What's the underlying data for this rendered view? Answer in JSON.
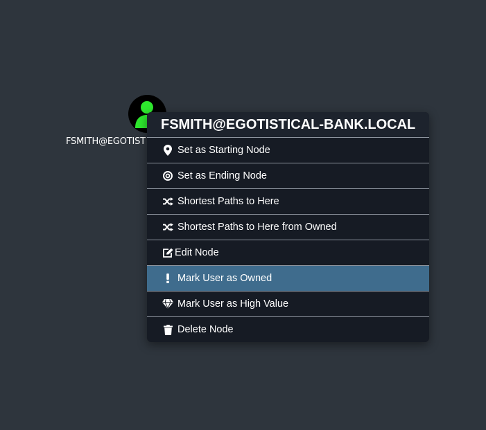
{
  "colors": {
    "background": "#2e353d",
    "menu_bg": "#161b24",
    "menu_header_bg": "#1d232d",
    "highlight": "#3f6c8d",
    "node_icon_green": "#2ee82e",
    "node_bg": "#000000",
    "text": "#ffffff",
    "divider": "#8f96a0"
  },
  "node": {
    "label": "FSMITH@EGOTISTICAL-BANK.LOCAL",
    "visible_label": "FSMITH@EGOTIST",
    "icon": "user-icon"
  },
  "menu": {
    "title": "FSMITH@EGOTISTICAL-BANK.LOCAL",
    "items": [
      {
        "label": "Set as Starting Node",
        "icon": "map-marker-icon"
      },
      {
        "label": "Set as Ending Node",
        "icon": "bullseye-icon"
      },
      {
        "label": "Shortest Paths to Here",
        "icon": "random-icon"
      },
      {
        "label": "Shortest Paths to Here from Owned",
        "icon": "random-icon"
      },
      {
        "label": "Edit Node",
        "icon": "edit-icon"
      },
      {
        "label": "Mark User as Owned",
        "icon": "exclamation-icon",
        "highlighted": true
      },
      {
        "label": "Mark User as High Value",
        "icon": "gem-icon"
      },
      {
        "label": "Delete Node",
        "icon": "trash-icon"
      }
    ]
  }
}
